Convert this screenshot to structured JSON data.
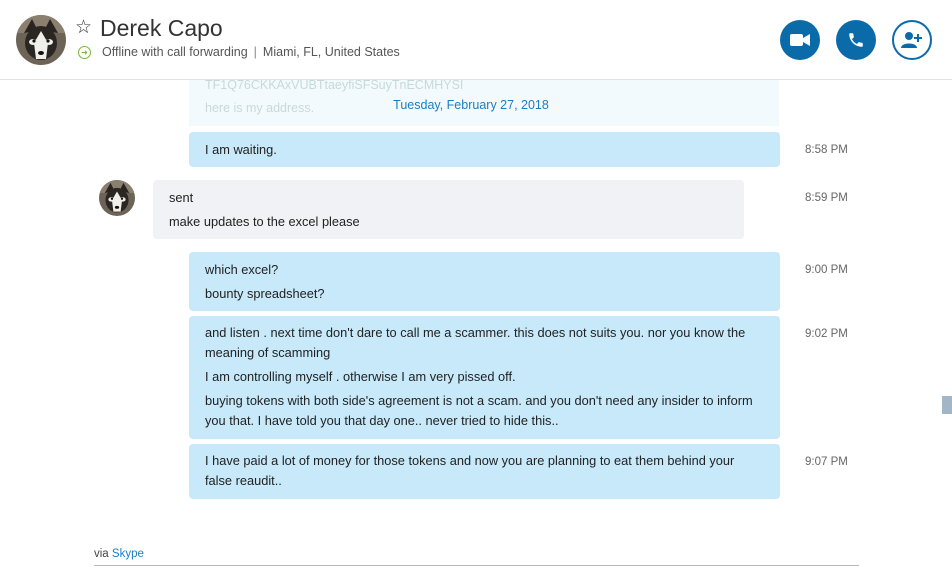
{
  "header": {
    "contact_name": "Derek Capo",
    "status_text": "Offline with call forwarding",
    "location": "Miami, FL, United States",
    "separator": "|",
    "star_glyph": "☆",
    "buttons": {
      "video_icon": "video-camera-icon",
      "call_icon": "phone-icon",
      "add_icon": "add-person-icon"
    }
  },
  "faded_messages": {
    "line1": "TF1Q76CKKAxVUBTtaeyfiSFSuyTnECMHYSI",
    "line2": "here is my address."
  },
  "date_separator": "Tuesday, February 27, 2018",
  "messages": [
    {
      "direction": "out",
      "time": "8:58 PM",
      "lines": [
        "I am waiting."
      ]
    },
    {
      "direction": "in",
      "time": "8:59 PM",
      "lines": [
        "sent",
        "make updates to the excel please"
      ]
    },
    {
      "direction": "out",
      "time": "9:00 PM",
      "lines": [
        "which excel?",
        "bounty spreadsheet?"
      ]
    },
    {
      "direction": "out",
      "time": "9:02 PM",
      "lines": [
        "and listen . next time don't dare to call me a scammer. this does not suits you. nor you know the meaning of scamming",
        "I am controlling myself . otherwise I am very pissed off.",
        "buying tokens with both side's agreement is not a scam. and you don't need any insider to inform you that. I have told you that day one.. never tried to hide this.."
      ]
    },
    {
      "direction": "out",
      "time": "9:07 PM",
      "lines": [
        "I have paid a lot of money for those tokens and now you are planning to eat them behind your false reaudit.."
      ]
    }
  ],
  "footer": {
    "via_label": "via",
    "via_link": "Skype"
  },
  "colors": {
    "accent": "#0a6ba8",
    "link": "#1a7fc1",
    "outgoing_bubble": "#c7e9f9",
    "incoming_bubble": "#f0f2f5",
    "status_green": "#7cb342"
  }
}
